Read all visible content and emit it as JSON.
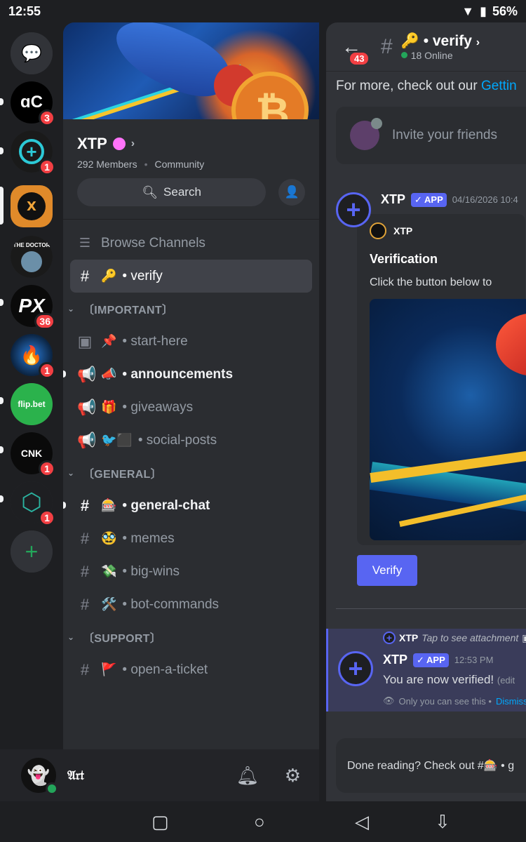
{
  "status": {
    "time": "12:55",
    "battery": "56%"
  },
  "rail": {
    "servers": [
      {
        "label": "DM",
        "badge": ""
      },
      {
        "label": "ɑC",
        "badge": "3"
      },
      {
        "label": "+",
        "badge": "1"
      },
      {
        "label": "XTP",
        "badge": ""
      },
      {
        "label": "THE DOCTOR",
        "badge": ""
      },
      {
        "label": "PX",
        "badge": "36"
      },
      {
        "label": "",
        "badge": "1"
      },
      {
        "label": "flip.bet",
        "badge": ""
      },
      {
        "label": "CNK",
        "badge": "1"
      },
      {
        "label": "",
        "badge": "1"
      },
      {
        "label": "+",
        "badge": ""
      }
    ]
  },
  "server": {
    "name": "XTP",
    "members": "292 Members",
    "type": "Community",
    "search_label": "Search"
  },
  "channels": {
    "browse": "Browse Channels",
    "active": {
      "emoji": "🔑",
      "name": "• verify"
    },
    "categories": [
      {
        "name": "〔IMPORTANT〕",
        "items": [
          {
            "icon": "▣",
            "emoji": "📌",
            "name": "• start-here",
            "unread": false
          },
          {
            "icon": "📢",
            "emoji": "📣",
            "name": "• announcements",
            "unread": true
          },
          {
            "icon": "📢",
            "emoji": "🎁",
            "name": "• giveaways",
            "unread": false
          },
          {
            "icon": "📢",
            "emoji": "🐦⬛",
            "name": "• social-posts",
            "unread": false
          }
        ]
      },
      {
        "name": "〔GENERAL〕",
        "items": [
          {
            "icon": "#",
            "emoji": "🎰",
            "name": "• general-chat",
            "unread": true
          },
          {
            "icon": "#",
            "emoji": "🥸",
            "name": "• memes",
            "unread": false
          },
          {
            "icon": "#",
            "emoji": "💸",
            "name": "• big-wins",
            "unread": false
          },
          {
            "icon": "#",
            "emoji": "🛠️",
            "name": "• bot-commands",
            "unread": false
          }
        ]
      },
      {
        "name": "〔SUPPORT〕",
        "items": [
          {
            "icon": "#",
            "emoji": "🚩",
            "name": "• open-a-ticket",
            "unread": false
          }
        ]
      }
    ]
  },
  "user": {
    "name": "𝔄𝔯𝔱"
  },
  "chat": {
    "back_badge": "43",
    "channel_emoji": "🔑",
    "channel_name": "• verify",
    "online": "18 Online",
    "more_text": "For more, check out our ",
    "more_link": "Gettin",
    "invite": "Invite your friends",
    "msg1": {
      "author": "XTP",
      "tag": "✓ APP",
      "time": "04/16/2026 10:4",
      "embed_author": "XTP",
      "embed_title": "Verification",
      "embed_desc": "Click the button below to",
      "button": "Verify"
    },
    "msg2": {
      "reply_author": "XTP",
      "reply_text": "Tap to see attachment",
      "author": "XTP",
      "tag": "✓ APP",
      "time": "12:53 PM",
      "text": "You are now verified!",
      "edited": "(edit",
      "only": "Only you can see this •",
      "dismiss": "Dismiss"
    },
    "done": "Done reading? Check out #🎰 • g"
  }
}
